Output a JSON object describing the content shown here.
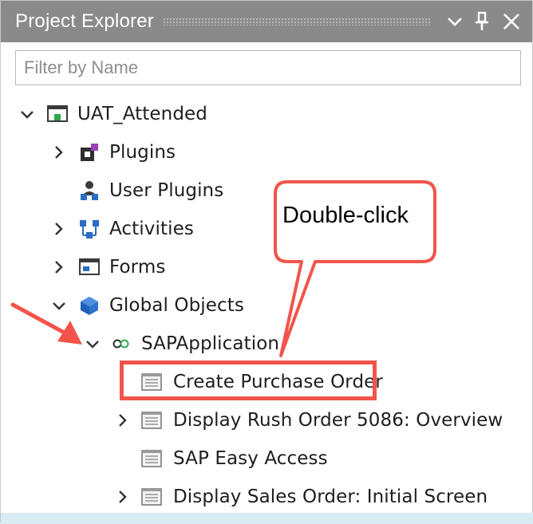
{
  "panel": {
    "title": "Project Explorer",
    "filter_placeholder": "Filter by Name"
  },
  "tree": {
    "root": "UAT_Attended",
    "plugins": "Plugins",
    "user_plugins": "User Plugins",
    "activities": "Activities",
    "forms": "Forms",
    "global_objects": "Global Objects",
    "sap_application": "SAPApplication",
    "screens": [
      "Create Purchase Order",
      "Display Rush Order 5086: Overview",
      "SAP Easy Access",
      "Display Sales Order: Initial Screen"
    ]
  },
  "annotation": {
    "callout": "Double-click",
    "accent_color": "#f2544a"
  },
  "icons": {
    "dropdown": "chevron-down-icon",
    "pin": "pin-icon",
    "close": "close-icon"
  }
}
